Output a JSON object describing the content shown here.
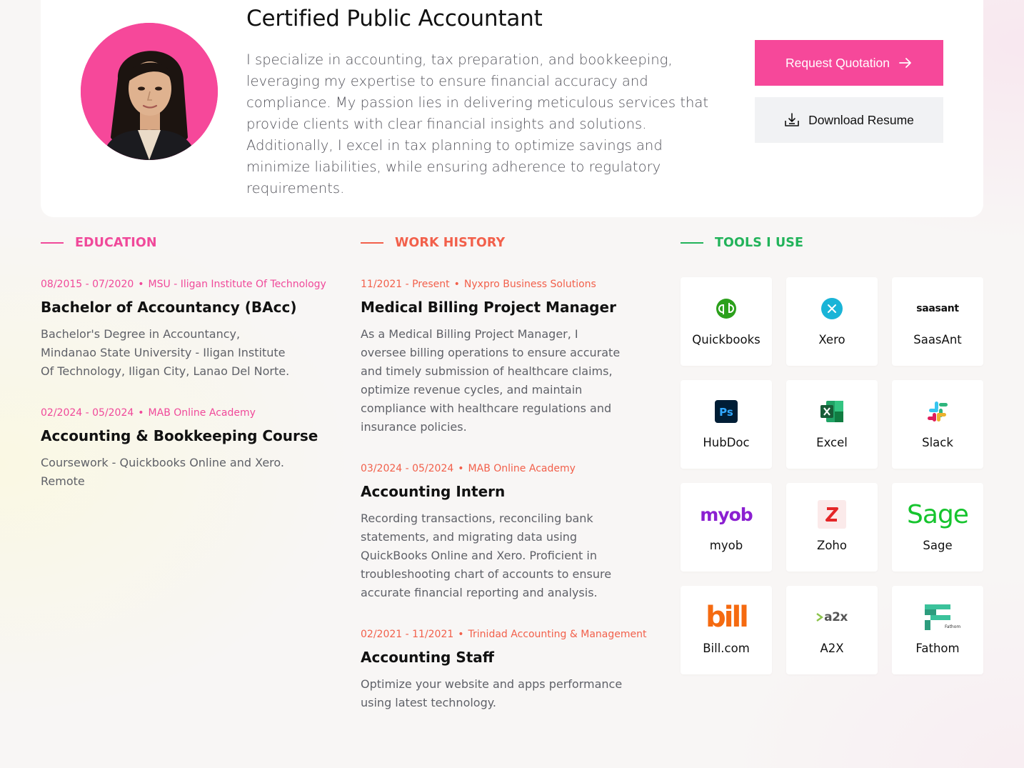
{
  "profile": {
    "headline": "Certified Public Accountant",
    "bio": "I specialize in accounting, tax preparation, and bookkeeping, leveraging my expertise to ensure financial accuracy and compliance. My passion lies in delivering meticulous services that provide clients with clear financial insights and solutions. Additionally, I excel in tax planning to optimize savings and minimize liabilities, while ensuring adherence to regulatory requirements.",
    "request_label": "Request Quotation",
    "resume_label": "Download Resume"
  },
  "education": {
    "heading": "EDUCATION",
    "items": [
      {
        "dates": "08/2015 - 07/2020",
        "org": "MSU - Iligan Institute Of Technology",
        "title": "Bachelor of Accountancy (BAcc)",
        "desc": "Bachelor's Degree in Accountancy, Mindanao State University - Iligan Institute Of Technology, Iligan City, Lanao Del Norte."
      },
      {
        "dates": "02/2024 - 05/2024",
        "org": "MAB Online Academy",
        "title": "Accounting & Bookkeeping Course",
        "desc": "Coursework - Quickbooks Online and Xero. Remote"
      }
    ]
  },
  "work": {
    "heading": "WORK HISTORY",
    "items": [
      {
        "dates": "11/2021 - Present",
        "org": "Nyxpro Business Solutions",
        "title": "Medical Billing Project Manager",
        "desc": "As a Medical Billing Project Manager, I oversee billing operations to ensure accurate and timely submission of healthcare claims, optimize revenue cycles, and maintain compliance with healthcare regulations and insurance policies."
      },
      {
        "dates": "03/2024 - 05/2024",
        "org": "MAB Online Academy",
        "title": "Accounting Intern",
        "desc": "Recording transactions, reconciling bank statements, and migrating data using QuickBooks Online and Xero. Proficient in troubleshooting chart of accounts to ensure accurate financial reporting and analysis."
      },
      {
        "dates": "02/2021 - 11/2021",
        "org": "Trinidad Accounting & Management",
        "title": "Accounting Staff",
        "desc": "Optimize your website and apps performance using latest technology."
      }
    ]
  },
  "tools": {
    "heading": "TOOLS I USE",
    "items": [
      {
        "name": "Quickbooks",
        "icon": "quickbooks-icon"
      },
      {
        "name": "Xero",
        "icon": "xero-icon"
      },
      {
        "name": "SaasAnt",
        "icon": "saasant-icon",
        "logo_text": "saasant"
      },
      {
        "name": "HubDoc",
        "icon": "hubdoc-icon"
      },
      {
        "name": "Excel",
        "icon": "excel-icon"
      },
      {
        "name": "Slack",
        "icon": "slack-icon"
      },
      {
        "name": "myob",
        "icon": "myob-icon",
        "logo_text": "myob"
      },
      {
        "name": "Zoho",
        "icon": "zoho-icon"
      },
      {
        "name": "Sage",
        "icon": "sage-icon",
        "logo_text": "Sage"
      },
      {
        "name": "Bill.com",
        "icon": "bill-icon",
        "logo_text": "bill"
      },
      {
        "name": "A2X",
        "icon": "a2x-icon",
        "logo_text": "a2x"
      },
      {
        "name": "Fathom",
        "icon": "fathom-icon",
        "logo_text": "Fathom"
      }
    ]
  },
  "colors": {
    "brand_pink": "#f6489a",
    "education_accent": "#f0499a",
    "work_accent": "#f2604b",
    "tools_accent": "#22b35a"
  }
}
